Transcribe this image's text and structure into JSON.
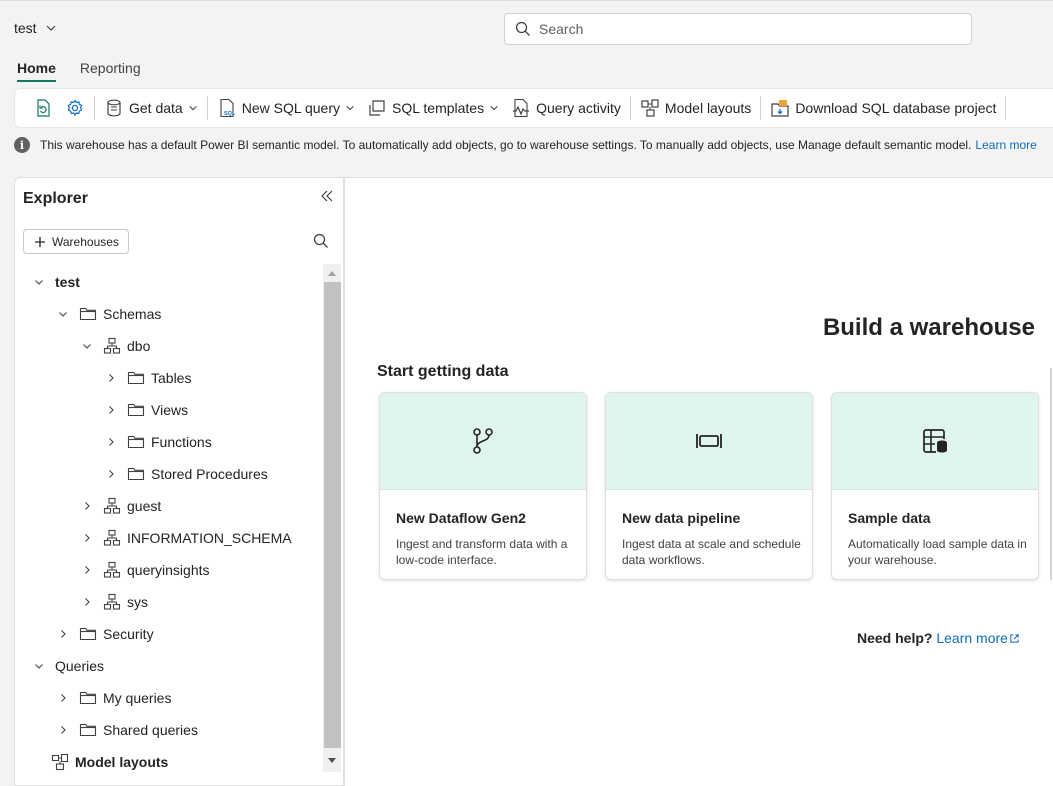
{
  "workspace": {
    "title": "test"
  },
  "search": {
    "placeholder": "Search"
  },
  "ribbon_tabs": [
    {
      "label": "Home",
      "active": true
    },
    {
      "label": "Reporting",
      "active": false
    }
  ],
  "toolbar": {
    "get_data": "Get data",
    "new_sql_query": "New SQL query",
    "sql_templates": "SQL templates",
    "query_activity": "Query activity",
    "model_layouts": "Model layouts",
    "download_project": "Download SQL database project"
  },
  "infobar": {
    "message": "This warehouse has a default Power BI semantic model. To automatically add objects, go to warehouse settings. To manually add objects, use Manage default semantic model.",
    "link": "Learn more"
  },
  "explorer": {
    "title": "Explorer",
    "add_button": "Warehouses",
    "tree": [
      {
        "label": "test",
        "level": 0,
        "state": "expanded",
        "icon": "none",
        "strong": true
      },
      {
        "label": "Schemas",
        "level": 1,
        "state": "expanded",
        "icon": "folder-icon"
      },
      {
        "label": "dbo",
        "level": 2,
        "state": "expanded",
        "icon": "schema-icon"
      },
      {
        "label": "Tables",
        "level": 3,
        "state": "collapsed",
        "icon": "folder-icon"
      },
      {
        "label": "Views",
        "level": 3,
        "state": "collapsed",
        "icon": "folder-icon"
      },
      {
        "label": "Functions",
        "level": 3,
        "state": "collapsed",
        "icon": "folder-icon"
      },
      {
        "label": "Stored Procedures",
        "level": 3,
        "state": "collapsed",
        "icon": "folder-icon"
      },
      {
        "label": "guest",
        "level": 2,
        "state": "collapsed",
        "icon": "schema-icon"
      },
      {
        "label": "INFORMATION_SCHEMA",
        "level": 2,
        "state": "collapsed",
        "icon": "schema-icon"
      },
      {
        "label": "queryinsights",
        "level": 2,
        "state": "collapsed",
        "icon": "schema-icon"
      },
      {
        "label": "sys",
        "level": 2,
        "state": "collapsed",
        "icon": "schema-icon"
      },
      {
        "label": "Security",
        "level": 1,
        "state": "collapsed",
        "icon": "folder-icon"
      },
      {
        "label": "Queries",
        "level": 0,
        "state": "expanded",
        "icon": "none"
      },
      {
        "label": "My queries",
        "level": 1,
        "state": "collapsed",
        "icon": "folder-icon"
      },
      {
        "label": "Shared queries",
        "level": 1,
        "state": "collapsed",
        "icon": "folder-icon"
      },
      {
        "label": "Model layouts",
        "level": 0,
        "state": "leaf",
        "icon": "model-layouts-icon",
        "strong": true
      }
    ]
  },
  "main": {
    "title": "Build a warehouse",
    "section_title": "Start getting data",
    "cards": [
      {
        "title": "New Dataflow Gen2",
        "description": "Ingest and transform data with a low-code interface.",
        "icon": "dataflow-icon"
      },
      {
        "title": "New data pipeline",
        "description": "Ingest data at scale and schedule data workflows.",
        "icon": "pipeline-icon"
      },
      {
        "title": "Sample data",
        "description": "Automatically load sample data in your warehouse.",
        "icon": "sample-data-icon"
      }
    ],
    "help_question": "Need help?",
    "help_link": "Learn more"
  },
  "colors": {
    "accent": "#117865",
    "card_header": "#e0f5ee",
    "link": "#0f6cbd"
  }
}
